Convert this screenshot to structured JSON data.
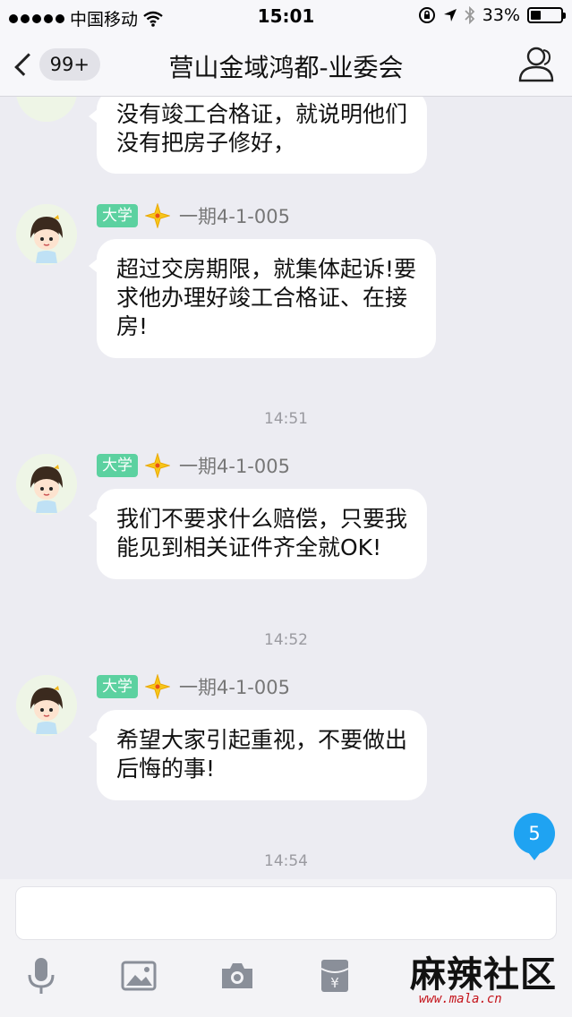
{
  "status_bar": {
    "carrier": "中国移动",
    "time": "15:01",
    "battery_percent": "33%",
    "battery_level": 0.33
  },
  "nav": {
    "unread_count": "99+",
    "title": "营山金域鸿都-业委会"
  },
  "messages": [
    {
      "lines": [
        "没有竣工合格证，就说明他们",
        "没有把房子修好，"
      ]
    },
    {
      "badge": "大学",
      "sender": "一期4-1-005",
      "lines": [
        "超过交房期限，就集体起诉!要",
        "求他办理好竣工合格证、在接",
        "房!"
      ]
    },
    {
      "timestamp": "14:51",
      "badge": "大学",
      "sender": "一期4-1-005",
      "lines": [
        "我们不要求什么赔偿，只要我",
        "能见到相关证件齐全就OK!"
      ]
    },
    {
      "timestamp": "14:52",
      "badge": "大学",
      "sender": "一期4-1-005",
      "lines": [
        "希望大家引起重视，不要做出",
        "后悔的事!"
      ]
    }
  ],
  "last_timestamp": "14:54",
  "new_messages_count": "5",
  "input": {
    "value": "",
    "placeholder": ""
  },
  "toolbar_icons": [
    "microphone-icon",
    "image-icon",
    "camera-icon",
    "red-packet-icon"
  ],
  "watermark": {
    "text": "麻辣社区",
    "url": "www.mala.cn"
  },
  "colors": {
    "badge": "#5cd1a0",
    "new_badge": "#1fa3f2",
    "background": "#ececf2"
  }
}
